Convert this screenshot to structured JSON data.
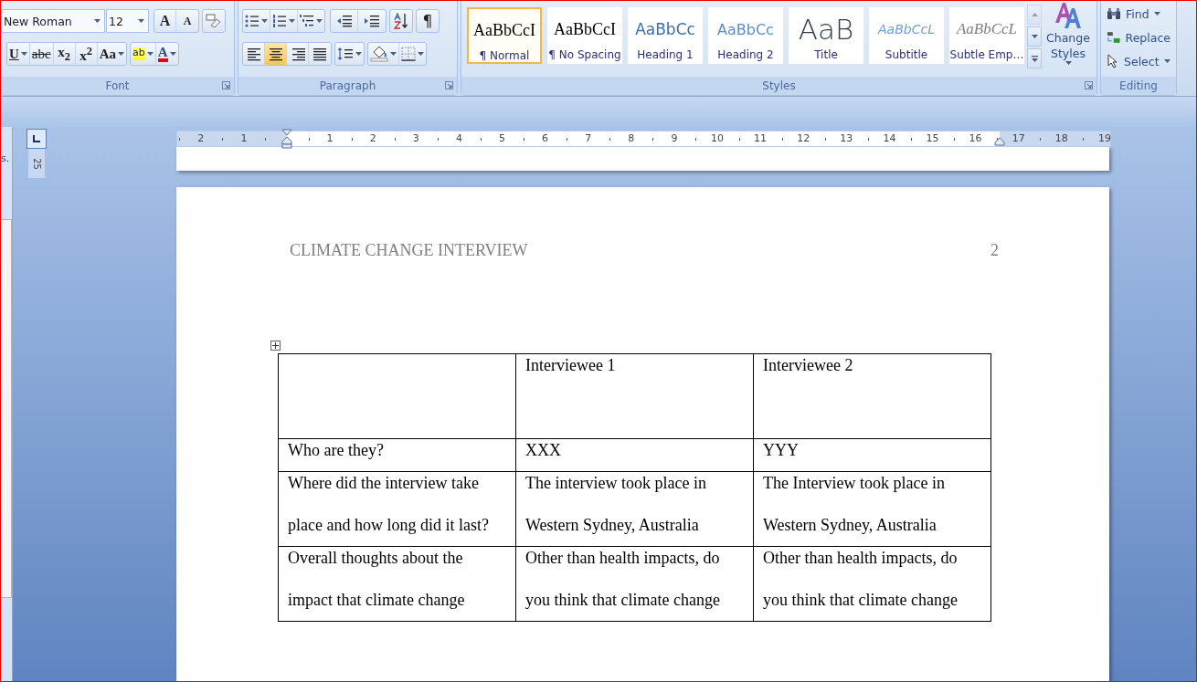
{
  "ribbon": {
    "font": {
      "label": "Font",
      "name": "New Roman",
      "size": "12",
      "grow_glyph": "A",
      "shrink_glyph": "A",
      "format_buttons": [
        {
          "kind": "underline",
          "glyph": "U",
          "caret": true
        },
        {
          "kind": "strike",
          "glyph": "abc",
          "caret": false
        },
        {
          "kind": "script",
          "glyph": "x$_{2}$",
          "caret": false
        },
        {
          "kind": "script",
          "glyph": "x$^{2}$",
          "caret": false
        },
        {
          "kind": "case",
          "glyph": "Aa",
          "caret": true
        }
      ],
      "color_buttons": [
        {
          "kind": "highlight",
          "glyph": "ab"
        },
        {
          "kind": "font-color",
          "glyph": "A"
        }
      ]
    },
    "paragraph": {
      "label": "Paragraph",
      "pilcrow": "¶",
      "alignment": [
        {
          "kind": "left",
          "selected": false
        },
        {
          "kind": "center",
          "selected": true
        },
        {
          "kind": "right",
          "selected": false
        },
        {
          "kind": "justify",
          "selected": false
        }
      ]
    },
    "styles": {
      "label": "Styles",
      "change_styles": "Change Styles",
      "gallery": [
        {
          "kind": "normal",
          "preview": "AaBbCcI",
          "name": "¶ Normal",
          "selected": true
        },
        {
          "kind": "normal",
          "preview": "AaBbCcI",
          "name": "¶ No Spacing",
          "selected": false
        },
        {
          "kind": "heading1",
          "preview": "AaBbCc",
          "name": "Heading 1",
          "selected": false
        },
        {
          "kind": "heading2",
          "preview": "AaBbCc",
          "name": "Heading 2",
          "selected": false
        },
        {
          "kind": "title",
          "preview": "AaB",
          "name": "Title",
          "selected": false
        },
        {
          "kind": "subtitle",
          "preview": "AaBbCcL",
          "name": "Subtitle",
          "selected": false
        },
        {
          "kind": "subtle",
          "preview": "AaBbCcL",
          "name": "Subtle Emp…",
          "selected": false
        }
      ]
    },
    "editing": {
      "label": "Editing",
      "items": [
        {
          "kind": "find",
          "label": "Find",
          "caret": true
        },
        {
          "kind": "replace",
          "label": "Replace",
          "caret": false
        },
        {
          "kind": "select",
          "label": "Select",
          "caret": true
        }
      ]
    }
  },
  "nav_pane_text": "s.",
  "vertical_ruler_number": "25",
  "ruler": {
    "left_margin_numbers": [
      "2",
      "1"
    ],
    "numbers": [
      "1",
      "2",
      "3",
      "4",
      "5",
      "6",
      "7",
      "8",
      "9",
      "10",
      "11",
      "12",
      "13",
      "14",
      "15",
      "16"
    ],
    "right_margin_numbers": [
      "17",
      "18",
      "19"
    ]
  },
  "document": {
    "header_title": "CLIMATE CHANGE INTERVIEW",
    "page_number": "2",
    "table": {
      "rows": [
        [
          "",
          "Interviewee 1",
          "Interviewee 2"
        ],
        [
          "Who are they?",
          "XXX",
          "YYY"
        ],
        [
          "Where did the interview take place and how long did it last?",
          "The interview took place in Western Sydney, Australia",
          "The Interview took place in Western Sydney, Australia"
        ],
        [
          "Overall thoughts about the impact that climate change",
          "Other than health impacts, do you think that climate change",
          "Other than health impacts, do you think that climate change"
        ]
      ]
    }
  }
}
